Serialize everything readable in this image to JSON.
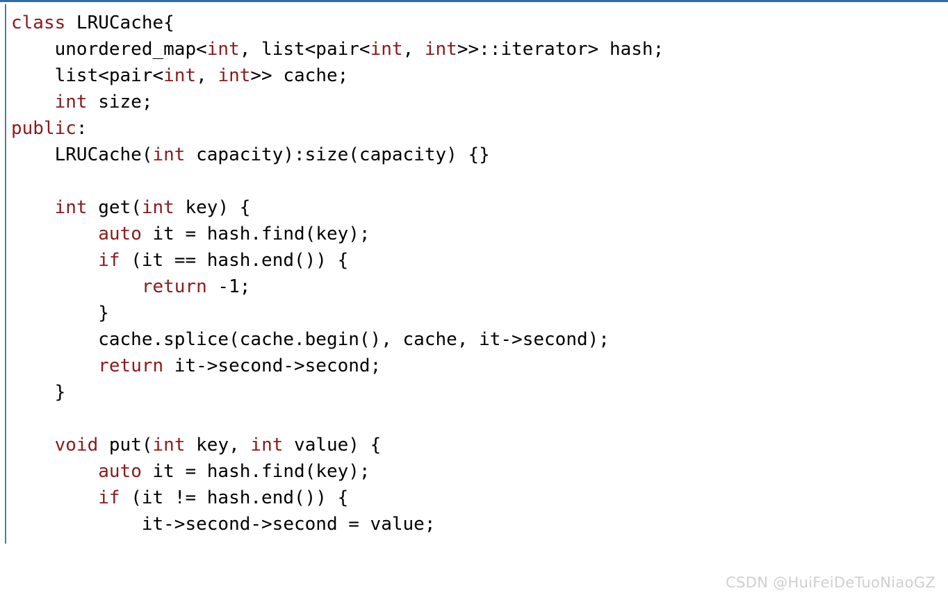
{
  "colors": {
    "background": "#ffffff",
    "text": "#000000",
    "keyword": "#8b1a1a",
    "border_top": "#2e6da4",
    "border_left": "#4a7bb0",
    "watermark": "#cfcfcf"
  },
  "code_block": {
    "language": "cpp",
    "lines": [
      [
        {
          "t": "class",
          "k": true
        },
        {
          "t": " LRUCache{",
          "k": false
        }
      ],
      [
        {
          "t": "    unordered_map<",
          "k": false
        },
        {
          "t": "int",
          "k": true
        },
        {
          "t": ", list<pair<",
          "k": false
        },
        {
          "t": "int",
          "k": true
        },
        {
          "t": ", ",
          "k": false
        },
        {
          "t": "int",
          "k": true
        },
        {
          "t": ">>::iterator> hash;",
          "k": false
        }
      ],
      [
        {
          "t": "    list<pair<",
          "k": false
        },
        {
          "t": "int",
          "k": true
        },
        {
          "t": ", ",
          "k": false
        },
        {
          "t": "int",
          "k": true
        },
        {
          "t": ">> cache;",
          "k": false
        }
      ],
      [
        {
          "t": "    ",
          "k": false
        },
        {
          "t": "int",
          "k": true
        },
        {
          "t": " size;",
          "k": false
        }
      ],
      [
        {
          "t": "public",
          "k": true
        },
        {
          "t": ":",
          "k": false
        }
      ],
      [
        {
          "t": "    LRUCache(",
          "k": false
        },
        {
          "t": "int",
          "k": true
        },
        {
          "t": " capacity):size(capacity) {}",
          "k": false
        }
      ],
      [
        {
          "t": "",
          "k": false
        }
      ],
      [
        {
          "t": "    ",
          "k": false
        },
        {
          "t": "int",
          "k": true
        },
        {
          "t": " get(",
          "k": false
        },
        {
          "t": "int",
          "k": true
        },
        {
          "t": " key) {",
          "k": false
        }
      ],
      [
        {
          "t": "        ",
          "k": false
        },
        {
          "t": "auto",
          "k": true
        },
        {
          "t": " it = hash.find(key);",
          "k": false
        }
      ],
      [
        {
          "t": "        ",
          "k": false
        },
        {
          "t": "if",
          "k": true
        },
        {
          "t": " (it == hash.end()) {",
          "k": false
        }
      ],
      [
        {
          "t": "            ",
          "k": false
        },
        {
          "t": "return",
          "k": true
        },
        {
          "t": " -1;",
          "k": false
        }
      ],
      [
        {
          "t": "        }",
          "k": false
        }
      ],
      [
        {
          "t": "        cache.splice(cache.begin(), cache, it->second);",
          "k": false
        }
      ],
      [
        {
          "t": "        ",
          "k": false
        },
        {
          "t": "return",
          "k": true
        },
        {
          "t": " it->second->second;",
          "k": false
        }
      ],
      [
        {
          "t": "    }",
          "k": false
        }
      ],
      [
        {
          "t": "",
          "k": false
        }
      ],
      [
        {
          "t": "    ",
          "k": false
        },
        {
          "t": "void",
          "k": true
        },
        {
          "t": " put(",
          "k": false
        },
        {
          "t": "int",
          "k": true
        },
        {
          "t": " key, ",
          "k": false
        },
        {
          "t": "int",
          "k": true
        },
        {
          "t": " value) {",
          "k": false
        }
      ],
      [
        {
          "t": "        ",
          "k": false
        },
        {
          "t": "auto",
          "k": true
        },
        {
          "t": " it = hash.find(key);",
          "k": false
        }
      ],
      [
        {
          "t": "        ",
          "k": false
        },
        {
          "t": "if",
          "k": true
        },
        {
          "t": " (it != hash.end()) {",
          "k": false
        }
      ],
      [
        {
          "t": "            it->second->second = value;",
          "k": false
        }
      ]
    ],
    "plain_text": "class LRUCache{\n    unordered_map<int, list<pair<int, int>>::iterator> hash;\n    list<pair<int, int>> cache;\n    int size;\npublic:\n    LRUCache(int capacity):size(capacity) {}\n\n    int get(int key) {\n        auto it = hash.find(key);\n        if (it == hash.end()) {\n            return -1;\n        }\n        cache.splice(cache.begin(), cache, it->second);\n        return it->second->second;\n    }\n\n    void put(int key, int value) {\n        auto it = hash.find(key);\n        if (it != hash.end()) {\n            it->second->second = value;"
  },
  "watermark": {
    "text": "CSDN @HuiFeiDeTuoNiaoGZ"
  }
}
